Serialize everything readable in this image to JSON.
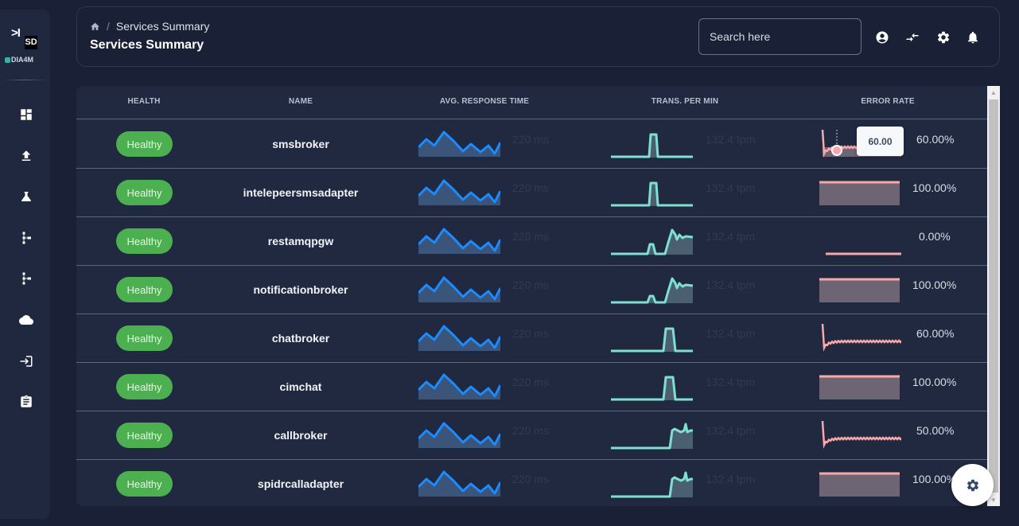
{
  "sidebar": {
    "logo_mark": ">I",
    "logo_sd": "SD",
    "brand": "DIA4M",
    "items": [
      {
        "name": "dashboard",
        "icon": "dashboard-icon"
      },
      {
        "name": "upload",
        "icon": "upload-icon"
      },
      {
        "name": "lab",
        "icon": "flask-icon"
      },
      {
        "name": "topology-1",
        "icon": "hierarchy-icon"
      },
      {
        "name": "topology-2",
        "icon": "hierarchy-icon"
      },
      {
        "name": "cloud",
        "icon": "cloud-icon"
      },
      {
        "name": "login",
        "icon": "login-icon"
      },
      {
        "name": "reports",
        "icon": "clipboard-icon"
      }
    ]
  },
  "header": {
    "breadcrumb_current": "Services Summary",
    "title": "Services Summary",
    "search_placeholder": "Search here",
    "icons": [
      "account-icon",
      "compare-arrows-icon",
      "settings-icon",
      "notifications-icon"
    ]
  },
  "table": {
    "columns": [
      "Health",
      "Name",
      "Avg. Response Time",
      "Trans. Per Min",
      "Error Rate"
    ],
    "rows": [
      {
        "health": "Healthy",
        "name": "smsbroker",
        "response_time": "220 ms",
        "tpm": "132.4 tpm",
        "error_rate": "60.00%",
        "tpm_shape": "pulse-mid",
        "err_shape": "decay-tooltip"
      },
      {
        "health": "Healthy",
        "name": "intelepeersmsadapter",
        "response_time": "220 ms",
        "tpm": "132.4 tpm",
        "error_rate": "100.00%",
        "tpm_shape": "pulse-mid",
        "err_shape": "full"
      },
      {
        "health": "Healthy",
        "name": "restamqpgw",
        "response_time": "220 ms",
        "tpm": "132.4 tpm",
        "error_rate": "0.00%",
        "tpm_shape": "pulse-rise",
        "err_shape": "zero"
      },
      {
        "health": "Healthy",
        "name": "notificationbroker",
        "response_time": "220 ms",
        "tpm": "132.4 tpm",
        "error_rate": "100.00%",
        "tpm_shape": "small-rise",
        "err_shape": "full"
      },
      {
        "health": "Healthy",
        "name": "chatbroker",
        "response_time": "220 ms",
        "tpm": "132.4 tpm",
        "error_rate": "60.00%",
        "tpm_shape": "pulse-late",
        "err_shape": "decay"
      },
      {
        "health": "Healthy",
        "name": "cimchat",
        "response_time": "220 ms",
        "tpm": "132.4 tpm",
        "error_rate": "100.00%",
        "tpm_shape": "pulse-late",
        "err_shape": "full"
      },
      {
        "health": "Healthy",
        "name": "callbroker",
        "response_time": "220 ms",
        "tpm": "132.4 tpm",
        "error_rate": "50.00%",
        "tpm_shape": "step-up",
        "err_shape": "decay"
      },
      {
        "health": "Healthy",
        "name": "spidrcalladapter",
        "response_time": "220 ms",
        "tpm": "132.4 tpm",
        "error_rate": "100.00%",
        "tpm_shape": "step-up",
        "err_shape": "full"
      }
    ],
    "tooltip_value": "60.00"
  },
  "colors": {
    "healthy": "#4caf50",
    "response_line": "#1a8cff",
    "tpm_line": "#7ee0d0",
    "error_line": "#f7a8a8"
  },
  "fab_icon": "settings-icon"
}
